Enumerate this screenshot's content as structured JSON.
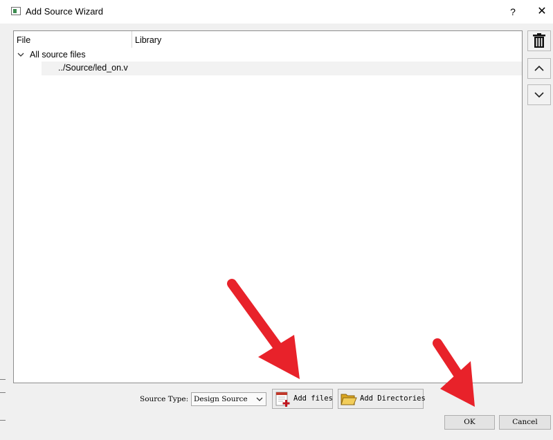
{
  "window": {
    "title": "Add Source Wizard",
    "help_label": "?",
    "close_label": "✕"
  },
  "file_list": {
    "columns": [
      "File",
      "Library"
    ],
    "root_label": "All source files",
    "files": [
      {
        "path": "../Source/led_on.v",
        "library": ""
      }
    ]
  },
  "side_buttons": {
    "delete_icon": "trash-icon",
    "up_icon": "chevron-up-icon",
    "down_icon": "chevron-down-icon"
  },
  "source_type": {
    "label": "Source Type:",
    "value": "Design Source"
  },
  "buttons": {
    "add_files": "Add files",
    "add_directories": "Add Directories",
    "ok": "OK",
    "cancel": "Cancel"
  },
  "annotation": {
    "arrow_color": "#e8222a"
  }
}
